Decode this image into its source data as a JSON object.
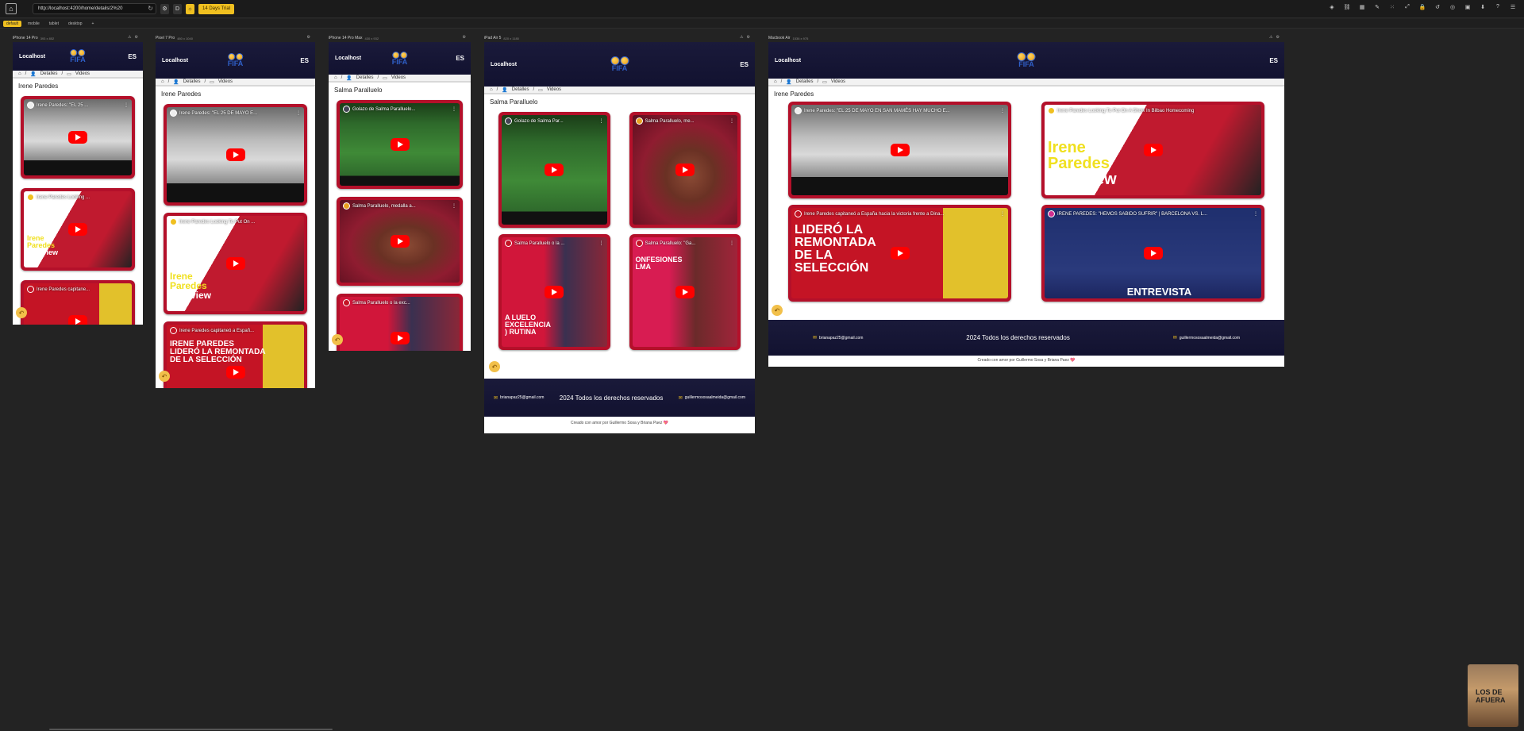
{
  "toolbar": {
    "url": "http://localhost:4200/home/details/2%20",
    "trial": "14 Days Trial"
  },
  "device_tabs": [
    "default",
    "mobile",
    "tablet",
    "desktop",
    "+"
  ],
  "site": {
    "brand": "Localhost",
    "lang": "ES",
    "logo_word": "FIFA",
    "breadcrumb": [
      "Detalles",
      "Videos"
    ],
    "footer_email_left": "brianapaz25@gmail.com",
    "footer_copy": "2024 Todos los derechos reservados",
    "footer_email_right": "guillermososaalmeida@gmail.com",
    "credit": "Creado con amor por Guillermo Sosa y Briana Paez 💖"
  },
  "devices": [
    {
      "name": "iPhone 14 Pro",
      "dims": "393 x 852",
      "title": "Irene Paredes"
    },
    {
      "name": "Pixel 7 Pro",
      "dims": "480 x 1040",
      "title": "Irene Paredes"
    },
    {
      "name": "iPhone 14 Pro Max",
      "dims": "430 x 932",
      "title": "Salma Paralluelo"
    },
    {
      "name": "iPad Air 5",
      "dims": "820 x 1180",
      "title": "Salma Paralluelo"
    },
    {
      "name": "Macbook Air",
      "dims": "1536 x 975",
      "title": "Irene Paredes"
    }
  ],
  "videos_irene": [
    "Irene Paredes: \"EL 25 DE MAYO EN SAN MAMÉS HAY MUCHO E...",
    "Irene Paredes Looking To Put On A Show In Bilbao Homecoming",
    "Irene Paredes capitaneó a España hacia la victoria frente a Dina...",
    "IRENE PAREDES: \"HEMOS SABIDO SUFRIR\" | BARCELONA VS. L..."
  ],
  "videos_salma": [
    "Golazo de Salma Paralluelo...",
    "Salma Paralluelo, medalla a...",
    "Salma Paralluelo o la exc...",
    "Salma Paralluelo: \"Ga..."
  ],
  "short_titles": {
    "p1v1": "Irene Paredes: \"EL 25 ...",
    "p1v2": "Irene Paredes Looking ...",
    "p1v3": "Irene Paredes capitane...",
    "p2v1": "Irene Paredes: \"EL 25 DE MAYO E...",
    "p2v2": "Irene Paredes Looking To Put On ...",
    "p2v3": "Irene Paredes capitaneó a Españ...",
    "ipad1": "Golazo de Salma Par...",
    "ipad2": "Salma Paralluelo, me...",
    "ipad3": "Salma Paralluelo o la ...",
    "ipad4": "Salma Paralluelo: \"Ga..."
  },
  "overlay_text": {
    "interview": "Irene Paredes Interview",
    "interview_l1": "Irene",
    "interview_l2": "Paredes",
    "interview_l3": "Interview",
    "seleccion": "LIDERÓ LA REMONTADA DE LA SELECCIÓN",
    "seleccion_short": "IRENE PAREDES LIDERÓ LA REMONTADA DE LA SELECCIÓN",
    "entrevista": "ENTREVISTA",
    "excelencia": "A LUELO EXCELENCIA ) RUTINA",
    "confesiones": "ONFESIONES LMA",
    "corner_thumb": "LOS DE AFUERA"
  },
  "colors": {
    "accent": "#f0c020",
    "card_red": "#b4102a",
    "navy": "#1a1a3a"
  }
}
